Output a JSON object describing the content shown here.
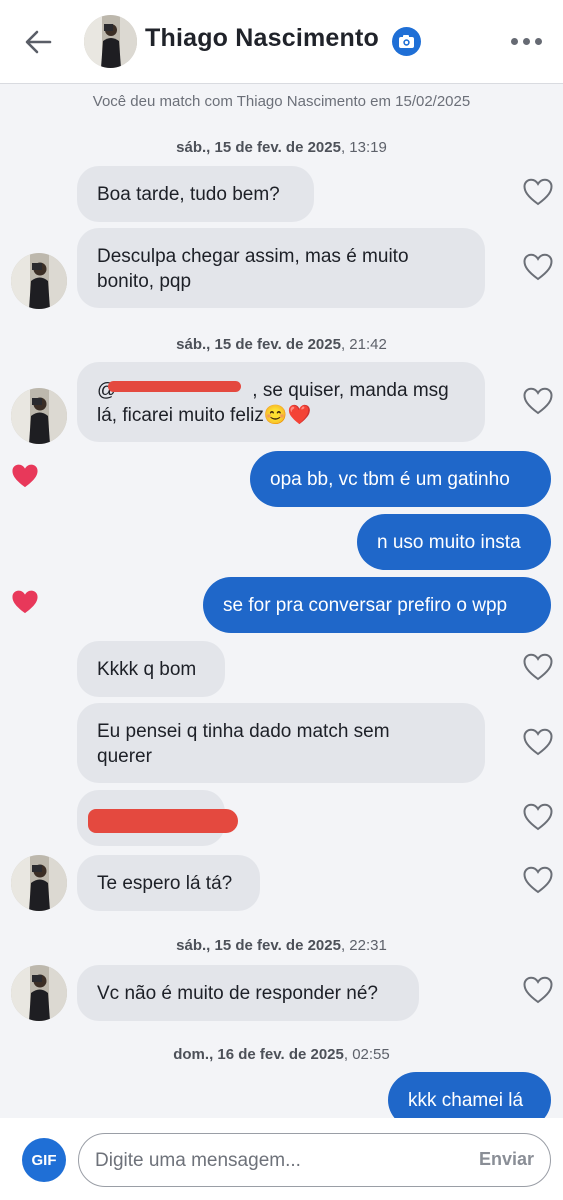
{
  "header": {
    "contact_name": "Thiago Nascimento",
    "icons": {
      "back": "arrow-left-icon",
      "badge": "camera-icon",
      "more": "more-dots-icon"
    }
  },
  "match_notice": "Você deu match com Thiago Nascimento em 15/02/2025",
  "date_separators": [
    {
      "day": "sáb., 15 de fev. de 2025",
      "time": ", 13:19"
    },
    {
      "day": "sáb., 15 de fev. de 2025",
      "time": ", 21:42"
    },
    {
      "day": "sáb., 15 de fev. de 2025",
      "time": ", 22:31"
    },
    {
      "day": "dom., 16 de fev. de 2025",
      "time": ", 02:55"
    }
  ],
  "messages": [
    {
      "direction": "incoming",
      "text": "Boa tarde, tudo bem?"
    },
    {
      "direction": "incoming",
      "line1": "Desculpa chegar assim, mas é muito",
      "line2": "bonito, pqp"
    },
    {
      "direction": "incoming",
      "line1_prefix": "@",
      "line1_rest": ", se quiser, manda msg",
      "line2": "lá, ficarei muito feliz😊❤️"
    },
    {
      "direction": "outgoing",
      "text": "opa bb, vc tbm é um gatinho",
      "liked": true
    },
    {
      "direction": "outgoing",
      "text": "n uso muito insta"
    },
    {
      "direction": "outgoing",
      "text": "se for pra conversar prefiro o wpp",
      "liked": true
    },
    {
      "direction": "incoming",
      "text": "Kkkk q bom"
    },
    {
      "direction": "incoming",
      "line1": "Eu pensei q tinha dado match sem",
      "line2": "querer"
    },
    {
      "direction": "incoming",
      "text": "",
      "redacted_link": true
    },
    {
      "direction": "incoming",
      "text": "Te espero lá tá?"
    },
    {
      "direction": "incoming",
      "text": "Vc não é muito de responder né?"
    },
    {
      "direction": "outgoing",
      "text": "kkk chamei lá"
    }
  ],
  "composer": {
    "gif_label": "GIF",
    "placeholder": "Digite uma mensagem...",
    "send_label": "Enviar"
  },
  "colors": {
    "outgoing_bubble": "#1f67c9",
    "incoming_bubble": "#e3e5ea",
    "like_heart": "#e8385a",
    "accent": "#1f6fd6",
    "redaction": "#e4493f"
  }
}
